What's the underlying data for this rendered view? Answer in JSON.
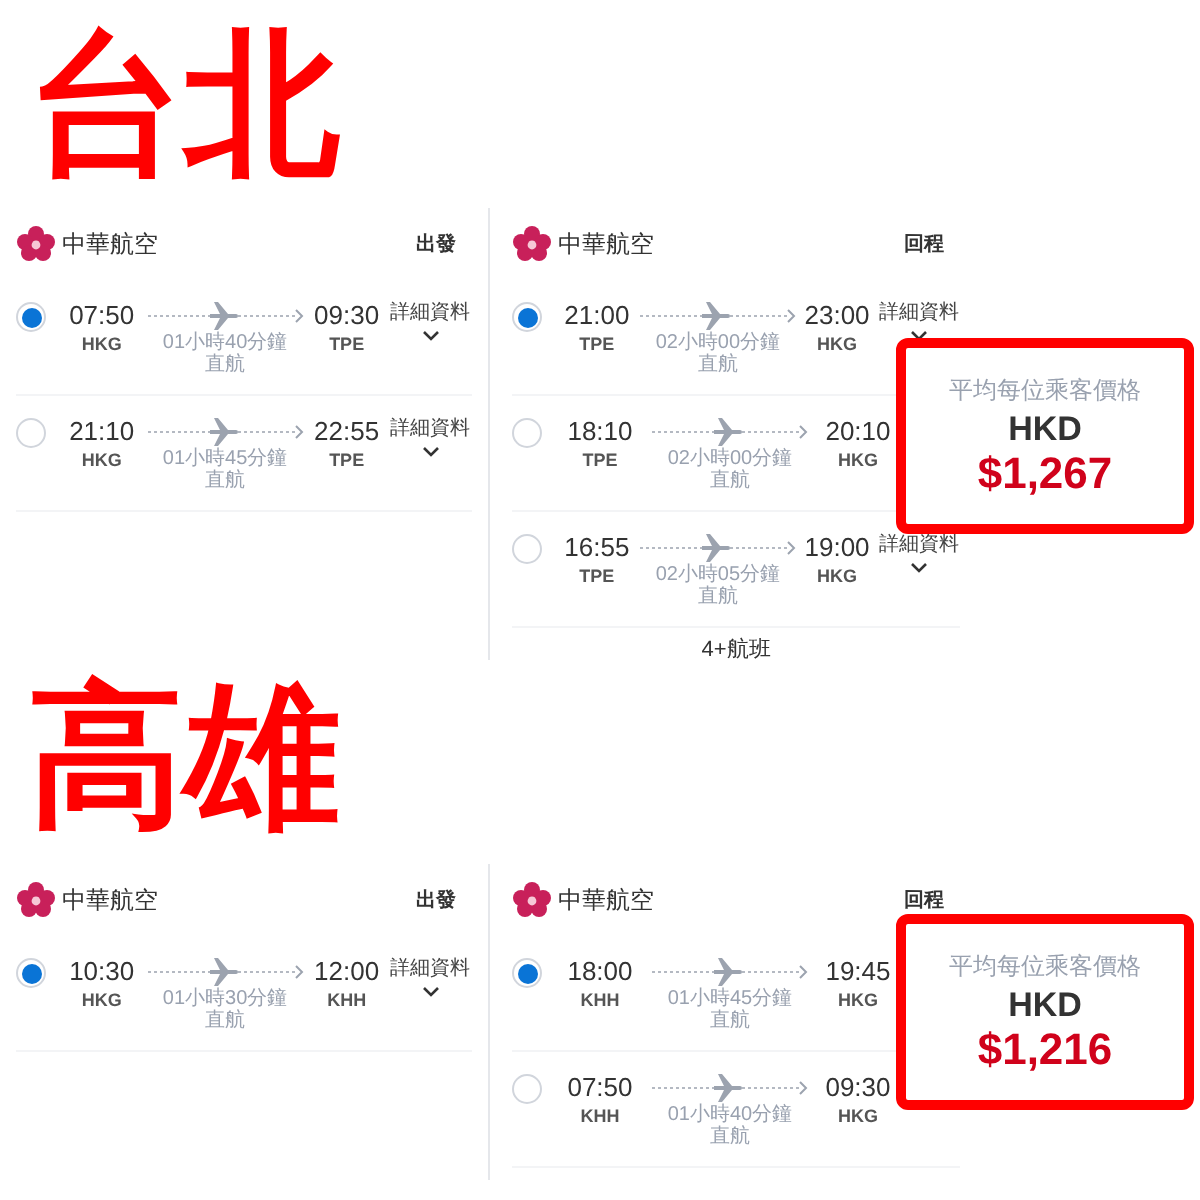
{
  "sections": [
    {
      "title": "台北",
      "panels": [
        {
          "airline": "中華航空",
          "direction": "出發",
          "flights": [
            {
              "selected": true,
              "depart_time": "07:50",
              "depart_code": "HKG",
              "duration": "01小時40分鐘",
              "stops": "直航",
              "arrive_time": "09:30",
              "arrive_code": "TPE",
              "details": "詳細資料"
            },
            {
              "selected": false,
              "depart_time": "21:10",
              "depart_code": "HKG",
              "duration": "01小時45分鐘",
              "stops": "直航",
              "arrive_time": "22:55",
              "arrive_code": "TPE",
              "details": "詳細資料"
            }
          ]
        },
        {
          "airline": "中華航空",
          "direction": "回程",
          "flights": [
            {
              "selected": true,
              "depart_time": "21:00",
              "depart_code": "TPE",
              "duration": "02小時00分鐘",
              "stops": "直航",
              "arrive_time": "23:00",
              "arrive_code": "HKG",
              "details": "詳細資料"
            },
            {
              "selected": false,
              "depart_time": "18:10",
              "depart_code": "TPE",
              "duration": "02小時00分鐘",
              "stops": "直航",
              "arrive_time": "20:10",
              "arrive_code": "HKG"
            },
            {
              "selected": false,
              "depart_time": "16:55",
              "depart_code": "TPE",
              "duration": "02小時05分鐘",
              "stops": "直航",
              "arrive_time": "19:00",
              "arrive_code": "HKG",
              "details": "詳細資料"
            }
          ],
          "more": "4+航班"
        }
      ],
      "price": {
        "label": "平均每位乘客價格",
        "currency": "HKD",
        "amount": "$1,267"
      }
    },
    {
      "title": "高雄",
      "panels": [
        {
          "airline": "中華航空",
          "direction": "出發",
          "flights": [
            {
              "selected": true,
              "depart_time": "10:30",
              "depart_code": "HKG",
              "duration": "01小時30分鐘",
              "stops": "直航",
              "arrive_time": "12:00",
              "arrive_code": "KHH",
              "details": "詳細資料"
            }
          ]
        },
        {
          "airline": "中華航空",
          "direction": "回程",
          "flights": [
            {
              "selected": true,
              "depart_time": "18:00",
              "depart_code": "KHH",
              "duration": "01小時45分鐘",
              "stops": "直航",
              "arrive_time": "19:45",
              "arrive_code": "HKG"
            },
            {
              "selected": false,
              "depart_time": "07:50",
              "depart_code": "KHH",
              "duration": "01小時40分鐘",
              "stops": "直航",
              "arrive_time": "09:30",
              "arrive_code": "HKG"
            }
          ]
        }
      ],
      "price": {
        "label": "平均每位乘客價格",
        "currency": "HKD",
        "amount": "$1,216"
      }
    }
  ]
}
